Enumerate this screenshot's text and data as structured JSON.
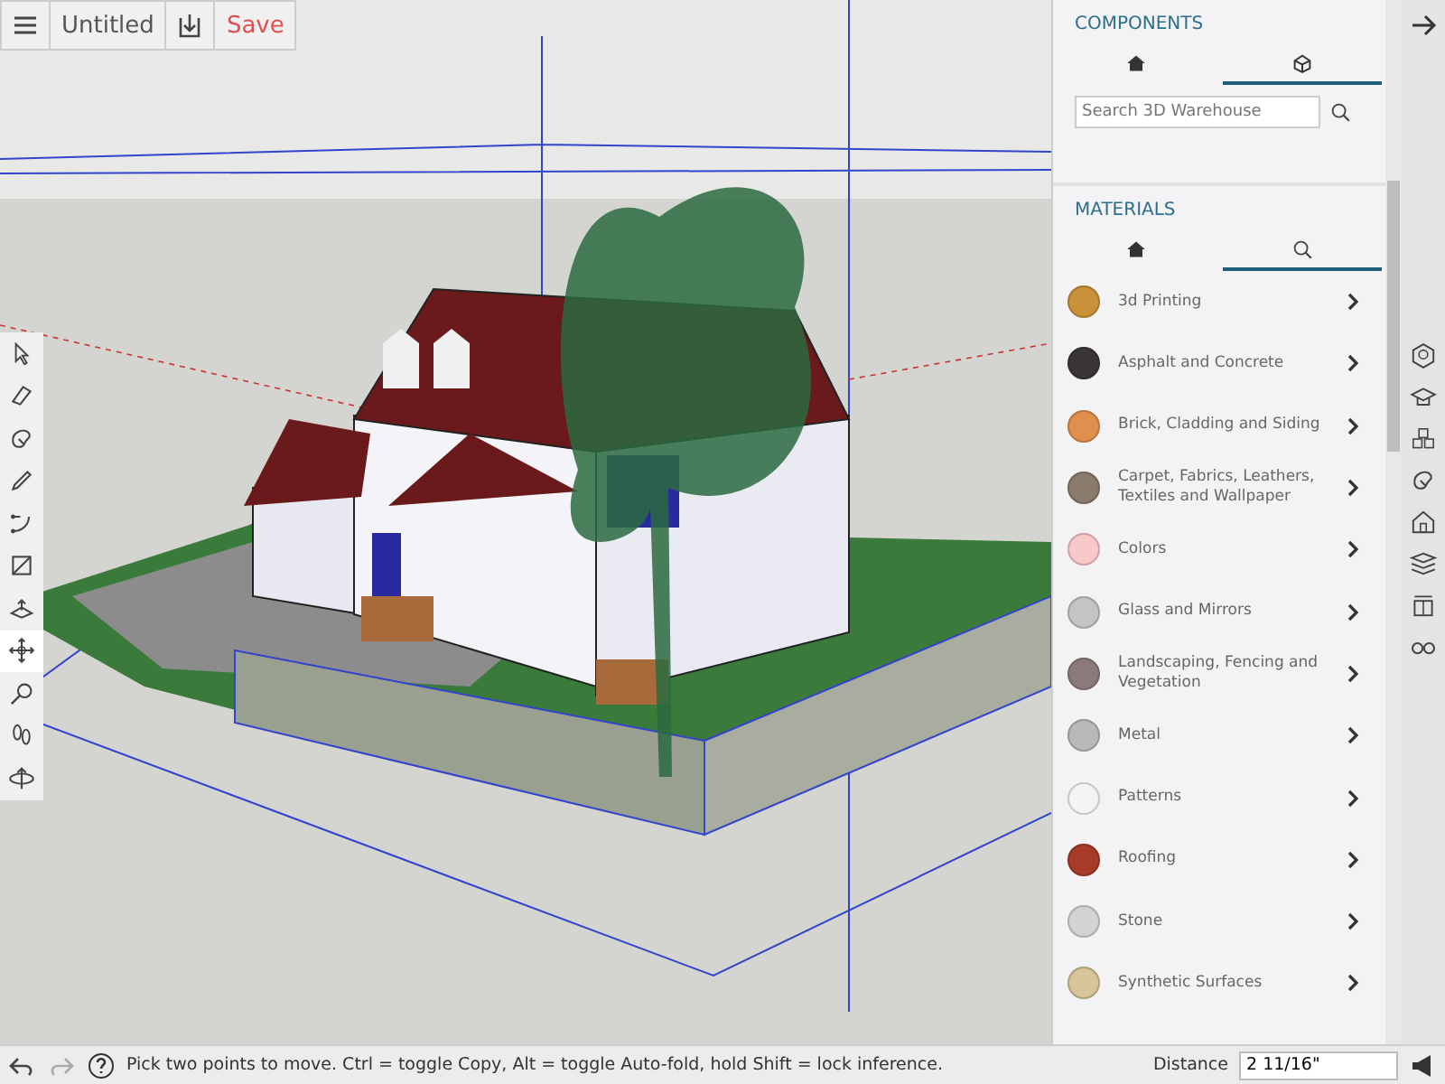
{
  "top_bar": {
    "title": "Untitled",
    "save_label": "Save"
  },
  "tools": [
    {
      "kind": "select",
      "selected": false
    },
    {
      "kind": "eraser",
      "selected": false
    },
    {
      "kind": "paint",
      "selected": false
    },
    {
      "kind": "pencil",
      "selected": false
    },
    {
      "kind": "arc",
      "selected": false
    },
    {
      "kind": "rectangle",
      "selected": false
    },
    {
      "kind": "pushpull",
      "selected": false
    },
    {
      "kind": "move",
      "selected": true
    },
    {
      "kind": "tape",
      "selected": false
    },
    {
      "kind": "walk",
      "selected": false
    },
    {
      "kind": "orbit",
      "selected": false
    }
  ],
  "components": {
    "title": "COMPONENTS",
    "tabs": [
      {
        "kind": "home",
        "selected": false
      },
      {
        "kind": "warehouse",
        "selected": true
      }
    ],
    "search": {
      "placeholder": "Search 3D Warehouse"
    }
  },
  "materials": {
    "title": "MATERIALS",
    "tabs": [
      {
        "kind": "home",
        "selected": false
      },
      {
        "kind": "search",
        "selected": true
      }
    ],
    "items": [
      {
        "label": "3d Printing",
        "color": "#c9923a"
      },
      {
        "label": "Asphalt and Concrete",
        "color": "#3a3538"
      },
      {
        "label": "Brick, Cladding and Siding",
        "color": "#e08f4e"
      },
      {
        "label": "Carpet, Fabrics, Leathers, Textiles and Wallpaper",
        "color": "#8a7a6a"
      },
      {
        "label": "Colors",
        "color": "#f8c8c8"
      },
      {
        "label": "Glass and Mirrors",
        "color": "#c4c4c4"
      },
      {
        "label": "Landscaping, Fencing and Vegetation",
        "color": "#8a7a7a"
      },
      {
        "label": "Metal",
        "color": "#b8b8b8"
      },
      {
        "label": "Patterns",
        "color": "#f4f4f4"
      },
      {
        "label": "Roofing",
        "color": "#a83a2a"
      },
      {
        "label": "Stone",
        "color": "#d4d4d4"
      },
      {
        "label": "Synthetic Surfaces",
        "color": "#d8c49a"
      }
    ]
  },
  "status_bar": {
    "hint": "Pick two points to move. Ctrl = toggle Copy, Alt = toggle Auto-fold, hold Shift = lock inference.",
    "measure_label": "Distance",
    "measure_value": "2 11/16\""
  }
}
